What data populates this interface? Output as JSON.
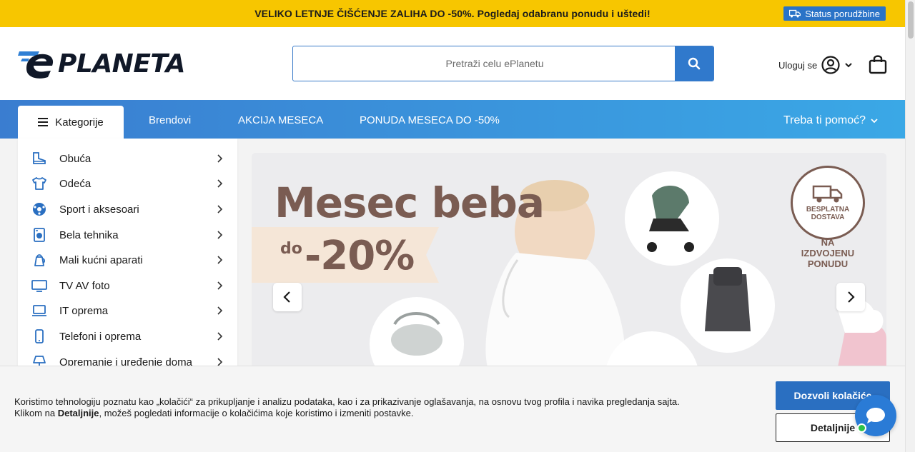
{
  "promo": {
    "text": "VELIKO LETNJE ČIŠĆENJE ZALIHA DO -50%. Pogledaj odabranu ponudu i uštedi!",
    "order_status": "Status porudžbine"
  },
  "header": {
    "logo_text": "PLANETA",
    "search_placeholder": "Pretraži celu ePlanetu",
    "login_label": "Uloguj se"
  },
  "nav": {
    "categories_label": "Kategorije",
    "links": [
      "Brendovi",
      "AKCIJA MESECA",
      "PONUDA MESECA DO -50%"
    ],
    "help": "Treba ti pomoć?"
  },
  "sidebar": {
    "items": [
      {
        "label": "Obuća",
        "icon": "shoe-icon"
      },
      {
        "label": "Odeća",
        "icon": "shirt-icon"
      },
      {
        "label": "Sport i aksesoari",
        "icon": "ball-icon"
      },
      {
        "label": "Bela tehnika",
        "icon": "washing-machine-icon"
      },
      {
        "label": "Mali kućni aparati",
        "icon": "kettle-icon"
      },
      {
        "label": "TV AV foto",
        "icon": "tv-icon"
      },
      {
        "label": "IT oprema",
        "icon": "laptop-icon"
      },
      {
        "label": "Telefoni i oprema",
        "icon": "phone-icon"
      },
      {
        "label": "Opremanje i uređenje doma",
        "icon": "lamp-icon"
      }
    ]
  },
  "banner": {
    "title": "Mesec beba",
    "prefix": "do",
    "discount": "-20%",
    "badge_line1": "BESPLATNA",
    "badge_line2": "DOSTAVA",
    "badge_sub": [
      "NA",
      "IZDVOJENU",
      "PONUDU"
    ]
  },
  "cookie": {
    "line1": "Koristimo tehnologiju poznatu kao „kolačići“ za prikupljanje i analizu podataka, kao i za prikazivanje oglašavanja, na osnovu tvog profila i navika pregledanja sajta.",
    "line2_prefix": "Klikom na ",
    "line2_bold": "Detaljnije",
    "line2_suffix": ", možeš pogledati informacije o kolačićima koje koristimo i izmeniti postavke.",
    "allow_label": "Dozvoli kolačiće",
    "details_label": "Detaljnije"
  },
  "colors": {
    "promo_bg": "#f7c600",
    "brand_blue": "#3079cc",
    "banner_brown": "#7a5c52"
  }
}
